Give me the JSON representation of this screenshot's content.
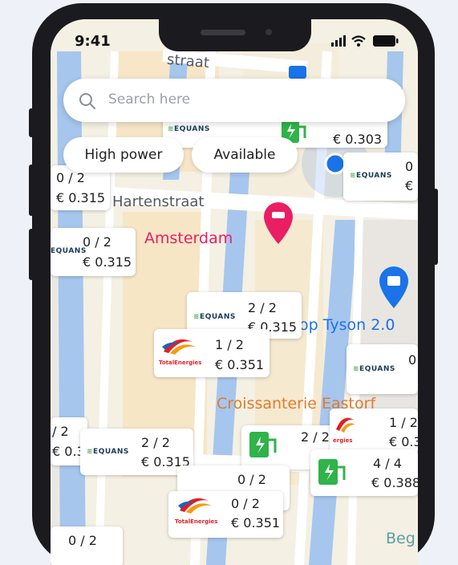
{
  "status": {
    "time": "9:41"
  },
  "search": {
    "placeholder": "Search here"
  },
  "filters": [
    {
      "label": "High power"
    },
    {
      "label": "Available"
    }
  ],
  "map_labels": {
    "street_top": "straat",
    "street_mid": "Hartenstraat",
    "hotel": "Amsterdam",
    "shop": "op Tyson 2.0",
    "cafe": "Croissanterie Eastorf",
    "bottom_right": "Beg"
  },
  "colors": {
    "hotel": "#e91e63",
    "shop": "#1a73e8",
    "cafe": "#e07b2e",
    "charger": "#2fb34a"
  },
  "stations": [
    {
      "count": "0 / 2",
      "price": "€ 0.315",
      "brand": "equans"
    },
    {
      "count": "",
      "price": "€ 0.303",
      "brand": "equans"
    },
    {
      "count": "0 / 2",
      "price": "€ 0.315",
      "brand": "equans"
    },
    {
      "count": "2 / 2",
      "price": "€ 0.315",
      "brand": "equans"
    },
    {
      "count": "1 / 2",
      "price": "€ 0.351",
      "brand": "totalenergies"
    },
    {
      "count": "2 / 2",
      "price": "€ 0.315",
      "brand": "equans"
    },
    {
      "count": "0 / 2",
      "price": "€ 0.351",
      "brand": "totalenergies"
    },
    {
      "count": "1 / 2",
      "price": "€ 0.3",
      "brand": "totalenergies"
    },
    {
      "count": "4 / 4",
      "price": "€ 0.388",
      "brand": "charger"
    },
    {
      "count": "2 / 2",
      "price": "",
      "brand": "charger"
    }
  ],
  "partial": {
    "a_count": "0 / 2",
    "a_price": "€ 0.315",
    "b_count": "0",
    "b_price": "€",
    "c_count": "0",
    "d_count": "/ 2",
    "d_price": "€ 0.31",
    "e_count": "0 / 2",
    "f_count": "0 / 2"
  },
  "brands": {
    "equans": "EQUANS",
    "total": "TotalEnergies",
    "total_short": "ergies"
  }
}
